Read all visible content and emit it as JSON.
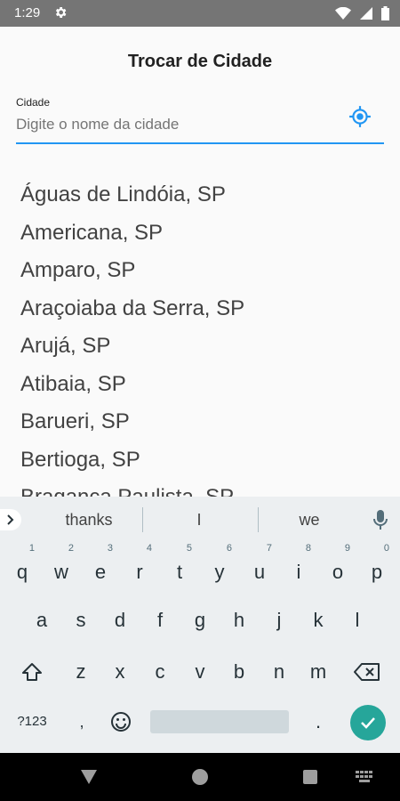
{
  "status": {
    "time": "1:29"
  },
  "page": {
    "title": "Trocar de Cidade"
  },
  "search": {
    "label": "Cidade",
    "placeholder": "Digite o nome da cidade",
    "value": ""
  },
  "cities": [
    "Águas de Lindóia, SP",
    "Americana, SP",
    "Amparo, SP",
    "Araçoiaba da Serra, SP",
    "Arujá, SP",
    "Atibaia, SP",
    "Barueri, SP",
    "Bertioga, SP",
    "Bragança Paulista, SP"
  ],
  "keyboard": {
    "suggestions": [
      "thanks",
      "I",
      "we"
    ],
    "row1": [
      "q",
      "w",
      "e",
      "r",
      "t",
      "y",
      "u",
      "i",
      "o",
      "p"
    ],
    "row1_digits": [
      "1",
      "2",
      "3",
      "4",
      "5",
      "6",
      "7",
      "8",
      "9",
      "0"
    ],
    "row2": [
      "a",
      "s",
      "d",
      "f",
      "g",
      "h",
      "j",
      "k",
      "l"
    ],
    "row3": [
      "z",
      "x",
      "c",
      "v",
      "b",
      "n",
      "m"
    ],
    "symbols_label": "?123",
    "comma": ",",
    "period": "."
  },
  "colors": {
    "accent": "#2196f3",
    "enter": "#26a69a",
    "status_bar": "#757575"
  },
  "icons": [
    "settings-icon",
    "wifi-icon",
    "signal-icon",
    "battery-icon",
    "my-location-icon",
    "chevron-right-icon",
    "mic-icon",
    "shift-icon",
    "backspace-icon",
    "emoji-icon",
    "check-icon",
    "back-icon",
    "home-icon",
    "recents-icon",
    "keyboard-switch-icon"
  ]
}
